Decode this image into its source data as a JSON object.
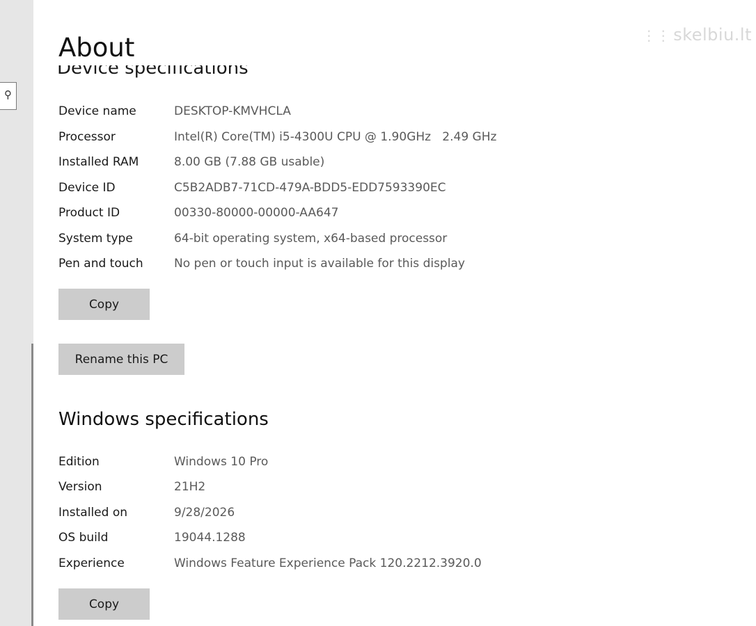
{
  "page": {
    "title": "About",
    "watermark": "skelbiu.lt"
  },
  "nav": {
    "search_icon": "search-icon"
  },
  "device_specs": {
    "heading": "Device specifications",
    "rows": [
      {
        "label": "Device name",
        "value": "DESKTOP-KMVHCLA"
      },
      {
        "label": "Processor",
        "value": "Intel(R) Core(TM) i5-4300U CPU @ 1.90GHz   2.49 GHz"
      },
      {
        "label": "Installed RAM",
        "value": "8.00 GB (7.88 GB usable)"
      },
      {
        "label": "Device ID",
        "value": "C5B2ADB7-71CD-479A-BDD5-EDD7593390EC"
      },
      {
        "label": "Product ID",
        "value": "00330-80000-00000-AA647"
      },
      {
        "label": "System type",
        "value": "64-bit operating system, x64-based processor"
      },
      {
        "label": "Pen and touch",
        "value": "No pen or touch input is available for this display"
      }
    ],
    "copy_label": "Copy",
    "rename_label": "Rename this PC"
  },
  "windows_specs": {
    "heading": "Windows specifications",
    "rows": [
      {
        "label": "Edition",
        "value": "Windows 10 Pro"
      },
      {
        "label": "Version",
        "value": "21H2"
      },
      {
        "label": "Installed on",
        "value": "9/28/2026"
      },
      {
        "label": "OS build",
        "value": "19044.1288"
      },
      {
        "label": "Experience",
        "value": "Windows Feature Experience Pack 120.2212.3920.0"
      }
    ],
    "copy_label": "Copy"
  },
  "colors": {
    "left_pane": "#e6e6e6",
    "button": "#cccccc",
    "value_text": "#5a5a5a"
  }
}
